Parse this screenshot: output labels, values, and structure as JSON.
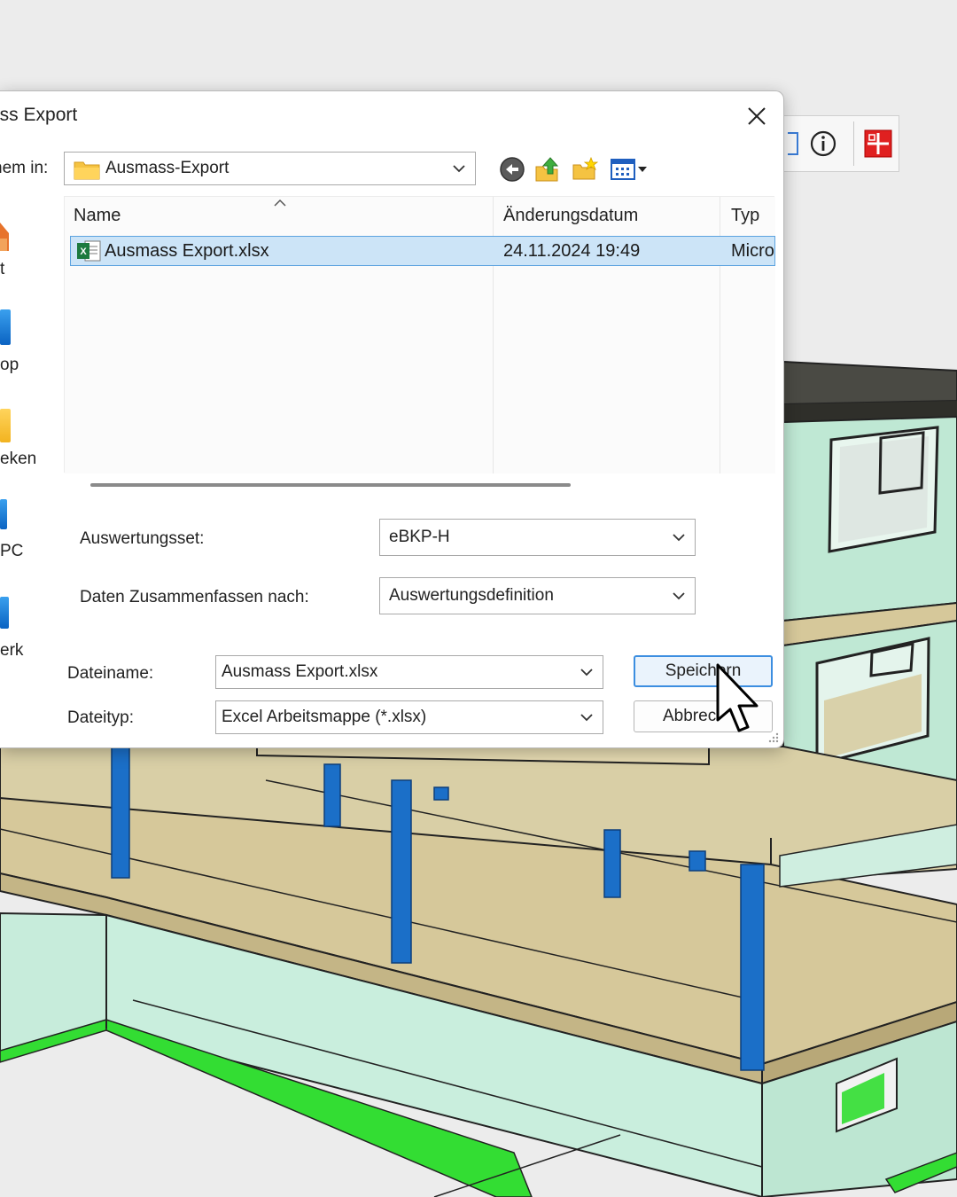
{
  "dialog": {
    "title": "ass Export",
    "look_in_label": "hem in:",
    "look_in_value": "Ausmass-Export",
    "places": [
      {
        "label": "t",
        "icon": "home-icon"
      },
      {
        "label": "op",
        "icon": "desktop-icon"
      },
      {
        "label": "eken",
        "icon": "libraries-icon"
      },
      {
        "label": "PC",
        "icon": "this-pc-icon"
      },
      {
        "label": "erk",
        "icon": "network-icon"
      }
    ],
    "columns": [
      "Name",
      "Änderungsdatum",
      "Typ"
    ],
    "files": [
      {
        "name": "Ausmass Export.xlsx",
        "date": "24.11.2024 19:49",
        "type": "Micro",
        "icon": "excel-file-icon"
      }
    ],
    "auswertungsset_label": "Auswertungsset:",
    "auswertungsset_value": "eBKP-H",
    "zusammenfassen_label": "Daten Zusammenfassen nach:",
    "zusammenfassen_value": "Auswertungsdefinition",
    "filename_label": "Dateiname:",
    "filename_value": "Ausmass Export.xlsx",
    "filetype_label": "Dateityp:",
    "filetype_value": "Excel Arbeitsmappe (*.xlsx)",
    "save_label": "Speichern",
    "cancel_label": "Abbrec"
  },
  "colors": {
    "selection": "#cce4f7",
    "accent": "#3c8ee0",
    "column_blue": "#1b6fc8",
    "floor": "#d6c89a",
    "wall": "#c9eedd",
    "green": "#33dd33"
  }
}
